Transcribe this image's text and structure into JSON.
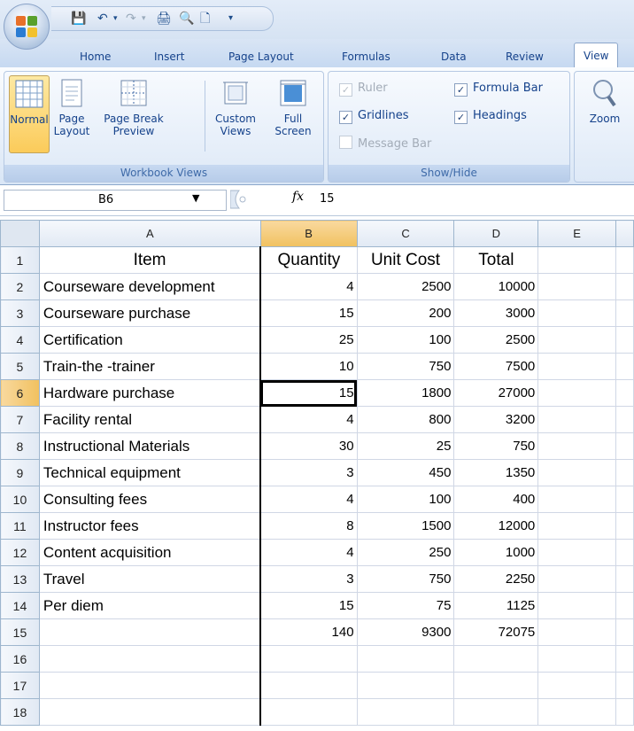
{
  "qat": {
    "icons": [
      "save-icon",
      "undo-icon",
      "redo-icon",
      "print-preview-icon",
      "new-icon",
      "customize-icon"
    ]
  },
  "tabs": [
    "Home",
    "Insert",
    "Page Layout",
    "Formulas",
    "Data",
    "Review",
    "View"
  ],
  "active_tab": "View",
  "workbook_views": {
    "label": "Workbook Views",
    "buttons": [
      {
        "line1": "Normal",
        "line2": ""
      },
      {
        "line1": "Page",
        "line2": "Layout"
      },
      {
        "line1": "Page Break",
        "line2": "Preview"
      },
      {
        "line1": "Custom",
        "line2": "Views"
      },
      {
        "line1": "Full",
        "line2": "Screen"
      }
    ]
  },
  "show_hide": {
    "label": "Show/Hide",
    "ruler": "Ruler",
    "formula_bar": "Formula Bar",
    "gridlines": "Gridlines",
    "headings": "Headings",
    "message_bar": "Message Bar"
  },
  "zoom": {
    "label": "Zoom"
  },
  "formula_bar": {
    "name_box": "B6",
    "fx": "fx",
    "value": "15"
  },
  "colors": {
    "accent": "#15428b",
    "selected_header": "#f1c15f"
  },
  "sheet": {
    "columns": [
      "A",
      "B",
      "C",
      "D",
      "E"
    ],
    "row_numbers": [
      "1",
      "2",
      "3",
      "4",
      "5",
      "6",
      "7",
      "8",
      "9",
      "10",
      "11",
      "12",
      "13",
      "14",
      "15",
      "16",
      "17",
      "18"
    ],
    "header_row": [
      "Item",
      "Quantity",
      "Unit Cost",
      "Total"
    ],
    "rows": [
      [
        "Courseware development",
        "4",
        "2500",
        "10000"
      ],
      [
        "Courseware purchase",
        "15",
        "200",
        "3000"
      ],
      [
        "Certification",
        "25",
        "100",
        "2500"
      ],
      [
        "Train-the -trainer",
        "10",
        "750",
        "7500"
      ],
      [
        "Hardware purchase",
        "15",
        "1800",
        "27000"
      ],
      [
        "Facility rental",
        "4",
        "800",
        "3200"
      ],
      [
        "Instructional Materials",
        "30",
        "25",
        "750"
      ],
      [
        "Technical equipment",
        "3",
        "450",
        "1350"
      ],
      [
        "Consulting fees",
        "4",
        "100",
        "400"
      ],
      [
        "Instructor fees",
        "8",
        "1500",
        "12000"
      ],
      [
        "Content acquisition",
        "4",
        "250",
        "1000"
      ],
      [
        "Travel",
        "3",
        "750",
        "2250"
      ],
      [
        "Per diem",
        "15",
        "75",
        "1125"
      ],
      [
        "",
        "140",
        "9300",
        "72075"
      ]
    ]
  }
}
